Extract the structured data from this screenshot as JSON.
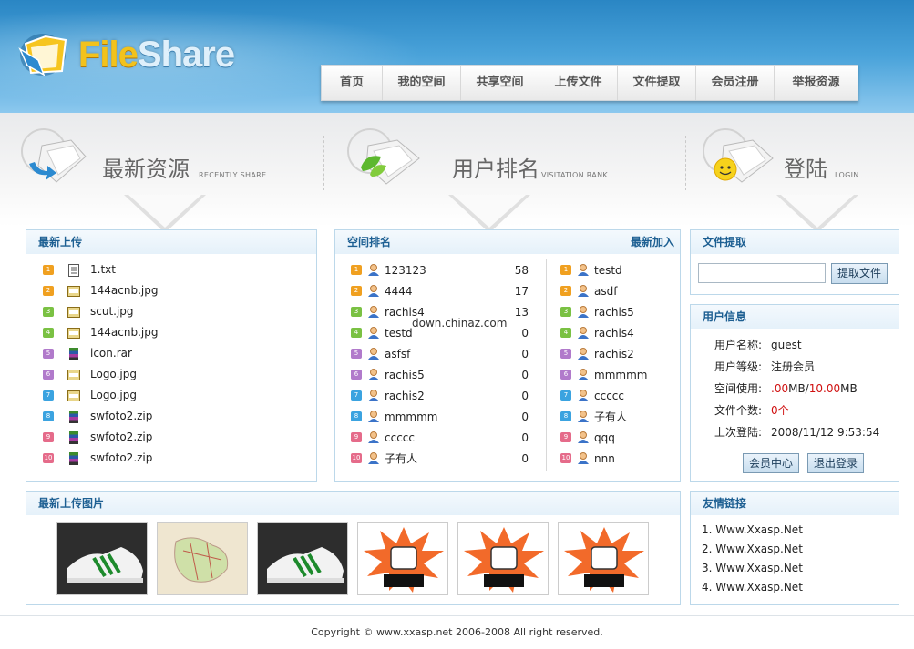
{
  "logo": {
    "part1": "File",
    "part2": "Share"
  },
  "nav": [
    "首页",
    "我的空间",
    "共享空间",
    "上传文件",
    "文件提取",
    "会员注册",
    "举报资源"
  ],
  "sections": [
    {
      "title": "最新资源",
      "en": "RECENTLY SHARE"
    },
    {
      "title": "用户排名",
      "en": "VISITATION RANK"
    },
    {
      "title": "登陆",
      "en": "LOGIN"
    }
  ],
  "latest": {
    "title": "最新上传",
    "files": [
      {
        "n": "1",
        "name": "1.txt",
        "type": "txt"
      },
      {
        "n": "2",
        "name": "144acnb.jpg",
        "type": "jpg"
      },
      {
        "n": "3",
        "name": "scut.jpg",
        "type": "jpg"
      },
      {
        "n": "4",
        "name": "144acnb.jpg",
        "type": "jpg"
      },
      {
        "n": "5",
        "name": "icon.rar",
        "type": "rar"
      },
      {
        "n": "6",
        "name": "Logo.jpg",
        "type": "jpg"
      },
      {
        "n": "7",
        "name": "Logo.jpg",
        "type": "jpg"
      },
      {
        "n": "8",
        "name": "swfoto2.zip",
        "type": "zip"
      },
      {
        "n": "9",
        "name": "swfoto2.zip",
        "type": "zip"
      },
      {
        "n": "10",
        "name": "swfoto2.zip",
        "type": "zip"
      }
    ]
  },
  "ranking": {
    "title": "空间排名",
    "newest_title": "最新加入",
    "rank": [
      {
        "n": "1",
        "name": "123123",
        "val": "58"
      },
      {
        "n": "2",
        "name": "4444",
        "val": "17"
      },
      {
        "n": "3",
        "name": "rachis4",
        "val": "13"
      },
      {
        "n": "4",
        "name": "testd",
        "val": "0"
      },
      {
        "n": "5",
        "name": "asfsf",
        "val": "0"
      },
      {
        "n": "6",
        "name": "rachis5",
        "val": "0"
      },
      {
        "n": "7",
        "name": "rachis2",
        "val": "0"
      },
      {
        "n": "8",
        "name": "mmmmm",
        "val": "0"
      },
      {
        "n": "9",
        "name": "ccccc",
        "val": "0"
      },
      {
        "n": "10",
        "name": "子有人",
        "val": "0"
      }
    ],
    "newest": [
      {
        "n": "1",
        "name": "testd"
      },
      {
        "n": "2",
        "name": "asdf"
      },
      {
        "n": "3",
        "name": "rachis5"
      },
      {
        "n": "4",
        "name": "rachis4"
      },
      {
        "n": "5",
        "name": "rachis2"
      },
      {
        "n": "6",
        "name": "mmmmm"
      },
      {
        "n": "7",
        "name": "ccccc"
      },
      {
        "n": "8",
        "name": "子有人"
      },
      {
        "n": "9",
        "name": "qqq"
      },
      {
        "n": "10",
        "name": "nnn"
      }
    ],
    "watermark": "down.chinaz.com"
  },
  "extract": {
    "title": "文件提取",
    "input_value": "",
    "button": "提取文件"
  },
  "userinfo": {
    "title": "用户信息",
    "rows": [
      {
        "k": "用户名称:",
        "v": "guest"
      },
      {
        "k": "用户等级:",
        "v": "注册会员"
      },
      {
        "k": "空间使用:",
        "used": ".00",
        "mid": "MB/",
        "total": "10.00",
        "tail": "MB"
      },
      {
        "k": "文件个数:",
        "count": "0",
        "unit": "个"
      },
      {
        "k": "上次登陆:",
        "v": "2008/11/12 9:53:54"
      }
    ],
    "btn_center": "会员中心",
    "btn_logout": "退出登录"
  },
  "pics": {
    "title": "最新上传图片"
  },
  "friends": {
    "title": "友情链接",
    "links": [
      "1. Www.Xxasp.Net",
      "2. Www.Xxasp.Net",
      "3. Www.Xxasp.Net",
      "4. Www.Xxasp.Net"
    ]
  },
  "footer": "Copyright © www.xxasp.net 2006-2008 All right reserved.",
  "colors": {
    "num": [
      "#f0a020",
      "#f0a020",
      "#7ac143",
      "#7ac143",
      "#b17acb",
      "#b17acb",
      "#3ba3e0",
      "#3ba3e0",
      "#e56b8a",
      "#e56b8a"
    ]
  }
}
